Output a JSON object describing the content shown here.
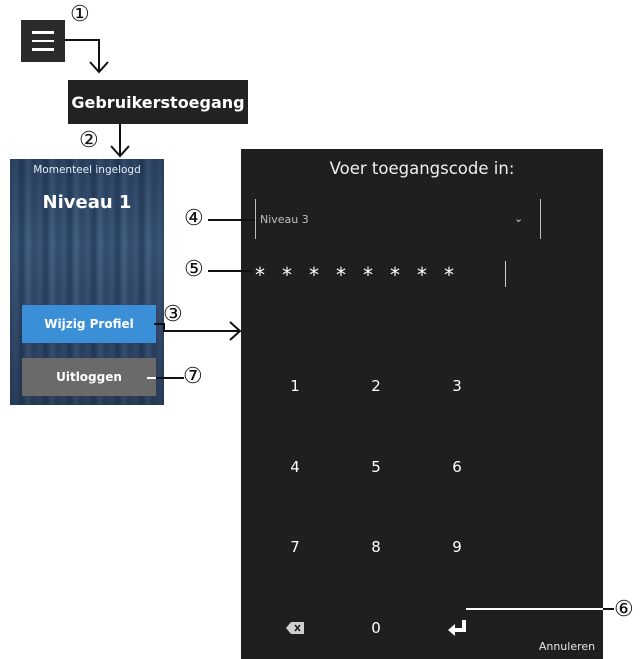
{
  "menu": {
    "icon": "hamburger-menu-icon"
  },
  "user_access_label": "Gebruikerstoegang",
  "callouts": [
    "①",
    "②",
    "③",
    "④",
    "⑤",
    "⑥",
    "⑦"
  ],
  "left_panel": {
    "logged_in_label": "Momenteel ingelogd",
    "level": "Niveau 1",
    "change_profile_label": "Wijzig Profiel",
    "logout_label": "Uitloggen",
    "colors": {
      "change_profile": "#3a8fd6",
      "logout": "#6a6a6a"
    }
  },
  "keypad_dialog": {
    "title": "Voer toegangscode in:",
    "level_select": {
      "value": "Niveau 3",
      "icon": "chevron-down-icon"
    },
    "password_mask": "********",
    "keys": {
      "k1": "1",
      "k2": "2",
      "k3": "3",
      "k4": "4",
      "k5": "5",
      "k6": "6",
      "k7": "7",
      "k8": "8",
      "k9": "9",
      "k0": "0"
    },
    "backspace_icon": "backspace-icon",
    "enter_icon": "enter-icon",
    "cancel_label": "Annuleren",
    "background": "#1f1f1f"
  }
}
